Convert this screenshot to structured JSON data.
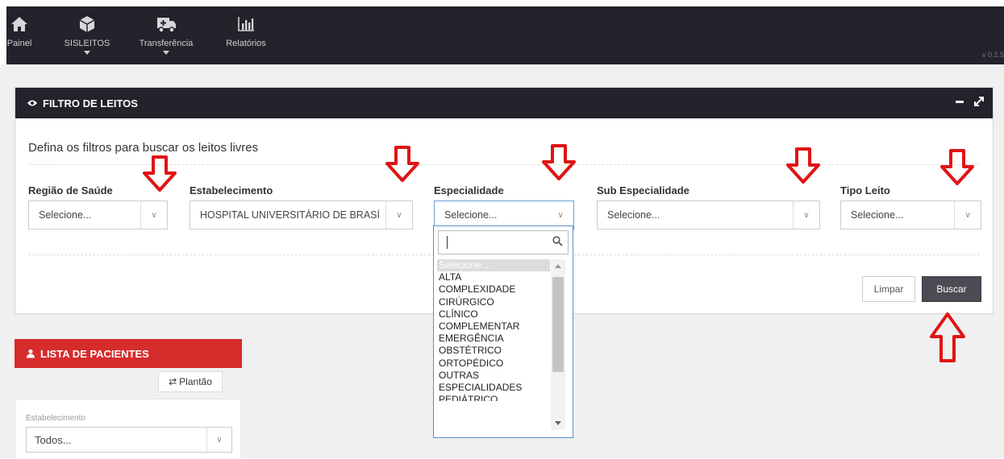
{
  "nav": {
    "items": [
      {
        "label": "Painel",
        "icon": "home-icon"
      },
      {
        "label": "SISLEITOS",
        "icon": "cube-icon"
      },
      {
        "label": "Transferência",
        "icon": "ambulance-icon"
      },
      {
        "label": "Relatórios",
        "icon": "bar-chart-icon"
      }
    ],
    "version": "v 0.2.5"
  },
  "filter_panel": {
    "title": "FILTRO DE LEITOS",
    "subtitle": "Defina os filtros para buscar os leitos livres",
    "fields": [
      {
        "label": "Região de Saúde",
        "value": "Selecione..."
      },
      {
        "label": "Estabelecimento",
        "value": "HOSPITAL UNIVERSITÁRIO DE BRASÍ"
      },
      {
        "label": "Especialidade",
        "value": "Selecione..."
      },
      {
        "label": "Sub Especialidade",
        "value": "Selecione..."
      },
      {
        "label": "Tipo Leito",
        "value": "Selecione..."
      }
    ],
    "clear_label": "Limpar",
    "search_label": "Buscar"
  },
  "dropdown": {
    "options": [
      "Selecione...",
      "ALTA",
      "COMPLEXIDADE",
      "CIRÚRGICO",
      "CLÍNICO",
      "COMPLEMENTAR",
      "EMERGÊNCIA",
      "OBSTÉTRICO",
      "ORTOPÉDICO",
      "OUTRAS",
      "ESPECIALIDADES",
      "PEDIÁTRICO"
    ]
  },
  "patients_panel": {
    "title": "LISTA DE PACIENTES",
    "toggle_label": "Plantão",
    "field_label": "Estabelecimento",
    "field_value": "Todos..."
  },
  "colors": {
    "nav_bg": "#22232b",
    "annotation_arrow": "#e01414",
    "patients_header": "#d62c2c",
    "search_button": "#4b4c53"
  }
}
